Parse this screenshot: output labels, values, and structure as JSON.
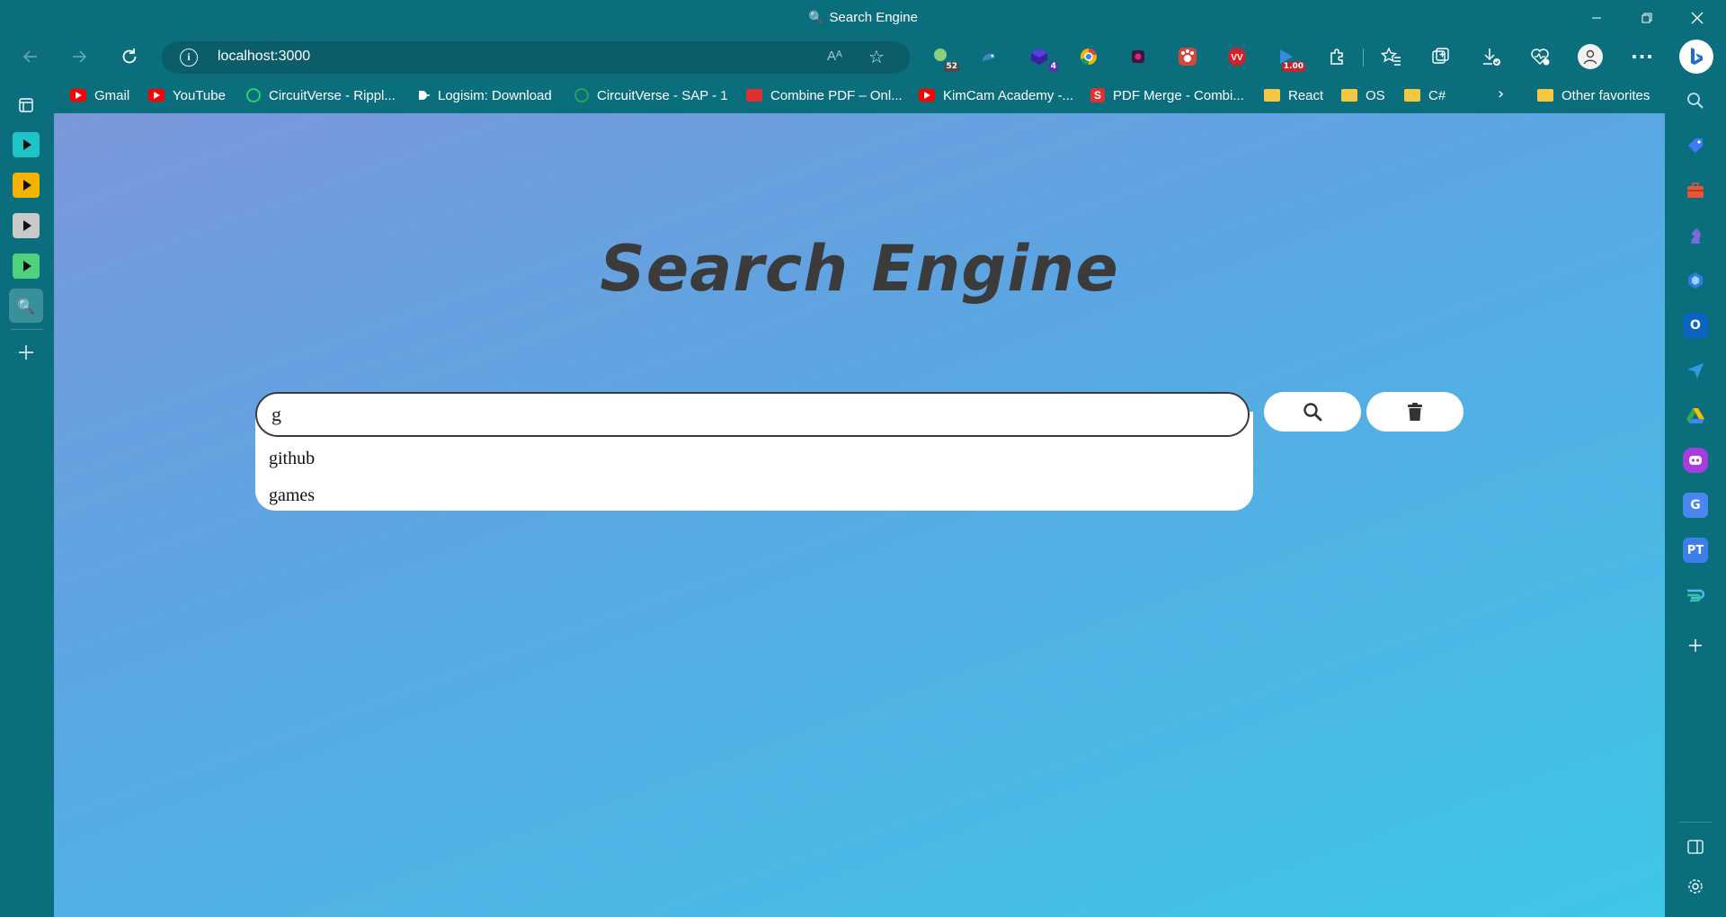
{
  "window": {
    "title": "Search Engine",
    "controls": [
      "minimize-icon",
      "restore-icon",
      "close-icon"
    ]
  },
  "toolbar": {
    "url": "localhost:3000",
    "read_aloud": "Aᴬ",
    "extensions": [
      {
        "name": "ext-badge-icon",
        "badge": "52"
      },
      {
        "name": "ext-dino-icon",
        "badge": ""
      },
      {
        "name": "ext-cube-icon",
        "badge": "4"
      },
      {
        "name": "ext-chrome-icon",
        "badge": ""
      },
      {
        "name": "ext-screen-icon",
        "badge": ""
      },
      {
        "name": "ext-paw-icon",
        "badge": ""
      },
      {
        "name": "ext-vv-icon",
        "badge": ""
      },
      {
        "name": "ext-speed-icon",
        "badge": "1.00"
      }
    ]
  },
  "bookmarks": [
    {
      "label": "Gmail",
      "icon": "yt"
    },
    {
      "label": "YouTube",
      "icon": "yt"
    },
    {
      "label": "CircuitVerse - Rippl...",
      "icon": "cv"
    },
    {
      "label": "Logisim: Download",
      "icon": "logi"
    },
    {
      "label": "CircuitVerse - SAP - 1",
      "icon": "cv2"
    },
    {
      "label": "Combine PDF – Onl...",
      "icon": "pdf"
    },
    {
      "label": "KimCam Academy -...",
      "icon": "yt"
    },
    {
      "label": "PDF Merge - Combi...",
      "icon": "spdf"
    },
    {
      "label": "React",
      "icon": "folder"
    },
    {
      "label": "OS",
      "icon": "folder"
    },
    {
      "label": "C#",
      "icon": "folder"
    }
  ],
  "other_favorites": "Other favorites",
  "left_tabs": {
    "colors": [
      "#1fc4c9",
      "#f5b301",
      "#c9c9c9",
      "#4fd27c"
    ]
  },
  "page": {
    "heading": "Search Engine",
    "search": {
      "value": "g",
      "suggestions": [
        "github",
        "games"
      ]
    }
  },
  "colors": {
    "chrome": "#0b6e7c",
    "heading_text": "#3b3b3b",
    "gradient_start": "#7b97dc",
    "gradient_end": "#3ec6e8"
  }
}
